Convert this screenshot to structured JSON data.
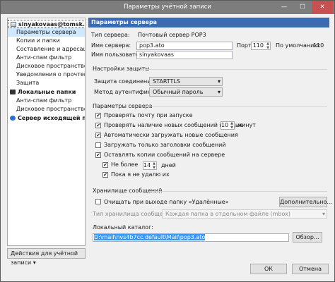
{
  "window": {
    "title": "Параметры учётной записи",
    "min_glyph": "—",
    "max_glyph": "☐",
    "close_glyph": "✕"
  },
  "sidebar": {
    "items": [
      {
        "label": "sinyakovaas@tomsk.gov.ru",
        "kind": "account",
        "icon": "envelope-icon"
      },
      {
        "label": "Параметры сервера",
        "kind": "sub",
        "selected": true
      },
      {
        "label": "Копии и папки",
        "kind": "sub"
      },
      {
        "label": "Составление и адресация",
        "kind": "sub"
      },
      {
        "label": "Анти-спам фильтр",
        "kind": "sub"
      },
      {
        "label": "Дисковое пространство",
        "kind": "sub"
      },
      {
        "label": "Уведомления о прочтении",
        "kind": "sub"
      },
      {
        "label": "Защита",
        "kind": "sub"
      },
      {
        "label": "Локальные папки",
        "kind": "account",
        "icon": "folder-icon"
      },
      {
        "label": "Анти-спам фильтр",
        "kind": "sub"
      },
      {
        "label": "Дисковое пространство",
        "kind": "sub"
      },
      {
        "label": "Сервер исходящей почт...",
        "kind": "account",
        "icon": "globe-icon"
      }
    ],
    "actions_label": "Действия для учётной записи",
    "actions_arrow": "▾"
  },
  "main": {
    "header": "Параметры сервера",
    "server_type_label": "Тип сервера:",
    "server_type_value": "Почтовый сервер POP3",
    "server_name_label": "Имя сервера:",
    "server_name_value": "pop3.ato",
    "port_label": "Порт:",
    "port_value": "110",
    "default_label": "По умолчанию:",
    "default_value": "110",
    "username_label": "Имя пользователя:",
    "username_value": "sinyakovaas",
    "security_group": "Настройки защиты",
    "conn_security_label": "Защита соединения:",
    "conn_security_value": "STARTTLS",
    "auth_label": "Метод аутентификации:",
    "auth_value": "Обычный пароль",
    "server_settings_group": "Параметры сервера",
    "check_on_start": "Проверять почту при запуске",
    "check_every": "Проверять наличие новых сообщений каждые",
    "check_every_value": "10",
    "minutes_label": "минут",
    "auto_download": "Автоматически загружать новые сообщения",
    "headers_only": "Загружать только заголовки сообщений",
    "leave_copies": "Оставлять копии сообщений на сервере",
    "no_more_than": "Не более",
    "no_more_value": "14",
    "days_label": "дней",
    "until_deleted": "Пока я не удалю их",
    "storage_group": "Хранилище сообщений",
    "empty_trash": "Очищать при выходе папку «Удалённые»",
    "advanced_button": "Дополнительно...",
    "storage_type_label": "Тип хранилища сообщений:",
    "storage_type_value": "Каждая папка в отдельном файле (mbox)",
    "local_dir_label": "Локальный каталог:",
    "local_dir_value": "D:\\mail\\nvs4b7cc.default\\Mail\\pop3.ato",
    "browse_button": "Обзор...",
    "ok_button": "ОК",
    "cancel_button": "Отмена",
    "check_glyph": "✔",
    "dropdown_glyph": "▾",
    "spin_up": "▲",
    "spin_down": "▼"
  }
}
